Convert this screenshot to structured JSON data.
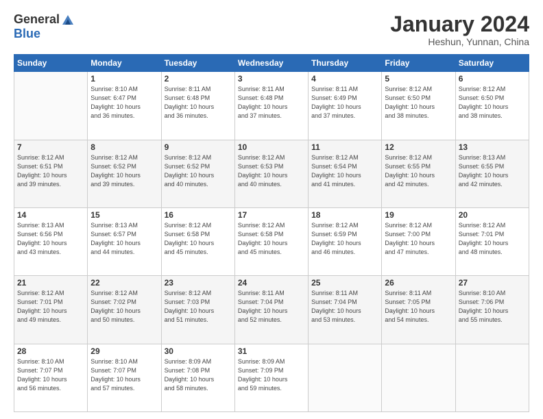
{
  "header": {
    "logo_general": "General",
    "logo_blue": "Blue",
    "month_title": "January 2024",
    "subtitle": "Heshun, Yunnan, China"
  },
  "days_of_week": [
    "Sunday",
    "Monday",
    "Tuesday",
    "Wednesday",
    "Thursday",
    "Friday",
    "Saturday"
  ],
  "weeks": [
    [
      {
        "num": "",
        "info": ""
      },
      {
        "num": "1",
        "info": "Sunrise: 8:10 AM\nSunset: 6:47 PM\nDaylight: 10 hours\nand 36 minutes."
      },
      {
        "num": "2",
        "info": "Sunrise: 8:11 AM\nSunset: 6:48 PM\nDaylight: 10 hours\nand 36 minutes."
      },
      {
        "num": "3",
        "info": "Sunrise: 8:11 AM\nSunset: 6:48 PM\nDaylight: 10 hours\nand 37 minutes."
      },
      {
        "num": "4",
        "info": "Sunrise: 8:11 AM\nSunset: 6:49 PM\nDaylight: 10 hours\nand 37 minutes."
      },
      {
        "num": "5",
        "info": "Sunrise: 8:12 AM\nSunset: 6:50 PM\nDaylight: 10 hours\nand 38 minutes."
      },
      {
        "num": "6",
        "info": "Sunrise: 8:12 AM\nSunset: 6:50 PM\nDaylight: 10 hours\nand 38 minutes."
      }
    ],
    [
      {
        "num": "7",
        "info": "Sunrise: 8:12 AM\nSunset: 6:51 PM\nDaylight: 10 hours\nand 39 minutes."
      },
      {
        "num": "8",
        "info": "Sunrise: 8:12 AM\nSunset: 6:52 PM\nDaylight: 10 hours\nand 39 minutes."
      },
      {
        "num": "9",
        "info": "Sunrise: 8:12 AM\nSunset: 6:52 PM\nDaylight: 10 hours\nand 40 minutes."
      },
      {
        "num": "10",
        "info": "Sunrise: 8:12 AM\nSunset: 6:53 PM\nDaylight: 10 hours\nand 40 minutes."
      },
      {
        "num": "11",
        "info": "Sunrise: 8:12 AM\nSunset: 6:54 PM\nDaylight: 10 hours\nand 41 minutes."
      },
      {
        "num": "12",
        "info": "Sunrise: 8:12 AM\nSunset: 6:55 PM\nDaylight: 10 hours\nand 42 minutes."
      },
      {
        "num": "13",
        "info": "Sunrise: 8:13 AM\nSunset: 6:55 PM\nDaylight: 10 hours\nand 42 minutes."
      }
    ],
    [
      {
        "num": "14",
        "info": "Sunrise: 8:13 AM\nSunset: 6:56 PM\nDaylight: 10 hours\nand 43 minutes."
      },
      {
        "num": "15",
        "info": "Sunrise: 8:13 AM\nSunset: 6:57 PM\nDaylight: 10 hours\nand 44 minutes."
      },
      {
        "num": "16",
        "info": "Sunrise: 8:12 AM\nSunset: 6:58 PM\nDaylight: 10 hours\nand 45 minutes."
      },
      {
        "num": "17",
        "info": "Sunrise: 8:12 AM\nSunset: 6:58 PM\nDaylight: 10 hours\nand 45 minutes."
      },
      {
        "num": "18",
        "info": "Sunrise: 8:12 AM\nSunset: 6:59 PM\nDaylight: 10 hours\nand 46 minutes."
      },
      {
        "num": "19",
        "info": "Sunrise: 8:12 AM\nSunset: 7:00 PM\nDaylight: 10 hours\nand 47 minutes."
      },
      {
        "num": "20",
        "info": "Sunrise: 8:12 AM\nSunset: 7:01 PM\nDaylight: 10 hours\nand 48 minutes."
      }
    ],
    [
      {
        "num": "21",
        "info": "Sunrise: 8:12 AM\nSunset: 7:01 PM\nDaylight: 10 hours\nand 49 minutes."
      },
      {
        "num": "22",
        "info": "Sunrise: 8:12 AM\nSunset: 7:02 PM\nDaylight: 10 hours\nand 50 minutes."
      },
      {
        "num": "23",
        "info": "Sunrise: 8:12 AM\nSunset: 7:03 PM\nDaylight: 10 hours\nand 51 minutes."
      },
      {
        "num": "24",
        "info": "Sunrise: 8:11 AM\nSunset: 7:04 PM\nDaylight: 10 hours\nand 52 minutes."
      },
      {
        "num": "25",
        "info": "Sunrise: 8:11 AM\nSunset: 7:04 PM\nDaylight: 10 hours\nand 53 minutes."
      },
      {
        "num": "26",
        "info": "Sunrise: 8:11 AM\nSunset: 7:05 PM\nDaylight: 10 hours\nand 54 minutes."
      },
      {
        "num": "27",
        "info": "Sunrise: 8:10 AM\nSunset: 7:06 PM\nDaylight: 10 hours\nand 55 minutes."
      }
    ],
    [
      {
        "num": "28",
        "info": "Sunrise: 8:10 AM\nSunset: 7:07 PM\nDaylight: 10 hours\nand 56 minutes."
      },
      {
        "num": "29",
        "info": "Sunrise: 8:10 AM\nSunset: 7:07 PM\nDaylight: 10 hours\nand 57 minutes."
      },
      {
        "num": "30",
        "info": "Sunrise: 8:09 AM\nSunset: 7:08 PM\nDaylight: 10 hours\nand 58 minutes."
      },
      {
        "num": "31",
        "info": "Sunrise: 8:09 AM\nSunset: 7:09 PM\nDaylight: 10 hours\nand 59 minutes."
      },
      {
        "num": "",
        "info": ""
      },
      {
        "num": "",
        "info": ""
      },
      {
        "num": "",
        "info": ""
      }
    ]
  ]
}
